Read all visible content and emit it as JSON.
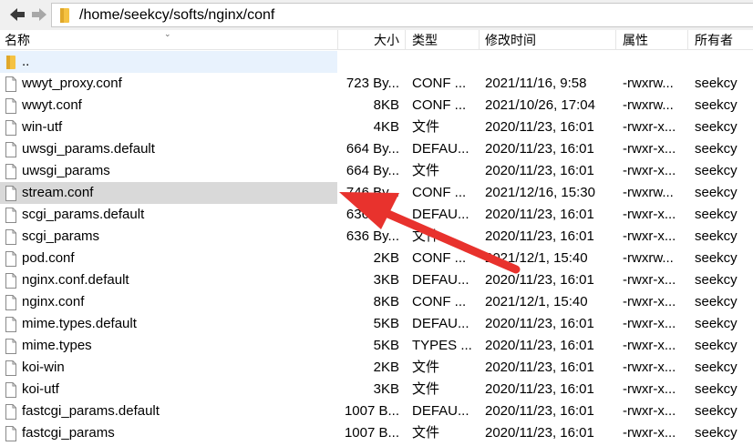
{
  "path": "/home/seekcy/softs/nginx/conf",
  "columns": {
    "name": "名称",
    "size": "大小",
    "type": "类型",
    "mtime": "修改时间",
    "perm": "属性",
    "owner": "所有者"
  },
  "parent_label": "..",
  "files": [
    {
      "name": "wwyt_proxy.conf",
      "size": "723 By...",
      "type": "CONF ...",
      "mtime": "2021/11/16, 9:58",
      "perm": "-rwxrw...",
      "owner": "seekcy"
    },
    {
      "name": "wwyt.conf",
      "size": "8KB",
      "type": "CONF ...",
      "mtime": "2021/10/26, 17:04",
      "perm": "-rwxrw...",
      "owner": "seekcy"
    },
    {
      "name": "win-utf",
      "size": "4KB",
      "type": "文件",
      "mtime": "2020/11/23, 16:01",
      "perm": "-rwxr-x...",
      "owner": "seekcy"
    },
    {
      "name": "uwsgi_params.default",
      "size": "664 By...",
      "type": "DEFAU...",
      "mtime": "2020/11/23, 16:01",
      "perm": "-rwxr-x...",
      "owner": "seekcy"
    },
    {
      "name": "uwsgi_params",
      "size": "664 By...",
      "type": "文件",
      "mtime": "2020/11/23, 16:01",
      "perm": "-rwxr-x...",
      "owner": "seekcy"
    },
    {
      "name": "stream.conf",
      "size": "746 By...",
      "type": "CONF ...",
      "mtime": "2021/12/16, 15:30",
      "perm": "-rwxrw...",
      "owner": "seekcy"
    },
    {
      "name": "scgi_params.default",
      "size": "636 By...",
      "type": "DEFAU...",
      "mtime": "2020/11/23, 16:01",
      "perm": "-rwxr-x...",
      "owner": "seekcy"
    },
    {
      "name": "scgi_params",
      "size": "636 By...",
      "type": "文件",
      "mtime": "2020/11/23, 16:01",
      "perm": "-rwxr-x...",
      "owner": "seekcy"
    },
    {
      "name": "pod.conf",
      "size": "2KB",
      "type": "CONF ...",
      "mtime": "2021/12/1, 15:40",
      "perm": "-rwxrw...",
      "owner": "seekcy"
    },
    {
      "name": "nginx.conf.default",
      "size": "3KB",
      "type": "DEFAU...",
      "mtime": "2020/11/23, 16:01",
      "perm": "-rwxr-x...",
      "owner": "seekcy"
    },
    {
      "name": "nginx.conf",
      "size": "8KB",
      "type": "CONF ...",
      "mtime": "2021/12/1, 15:40",
      "perm": "-rwxr-x...",
      "owner": "seekcy"
    },
    {
      "name": "mime.types.default",
      "size": "5KB",
      "type": "DEFAU...",
      "mtime": "2020/11/23, 16:01",
      "perm": "-rwxr-x...",
      "owner": "seekcy"
    },
    {
      "name": "mime.types",
      "size": "5KB",
      "type": "TYPES ...",
      "mtime": "2020/11/23, 16:01",
      "perm": "-rwxr-x...",
      "owner": "seekcy"
    },
    {
      "name": "koi-win",
      "size": "2KB",
      "type": "文件",
      "mtime": "2020/11/23, 16:01",
      "perm": "-rwxr-x...",
      "owner": "seekcy"
    },
    {
      "name": "koi-utf",
      "size": "3KB",
      "type": "文件",
      "mtime": "2020/11/23, 16:01",
      "perm": "-rwxr-x...",
      "owner": "seekcy"
    },
    {
      "name": "fastcgi_params.default",
      "size": "1007 B...",
      "type": "DEFAU...",
      "mtime": "2020/11/23, 16:01",
      "perm": "-rwxr-x...",
      "owner": "seekcy"
    },
    {
      "name": "fastcgi_params",
      "size": "1007 B...",
      "type": "文件",
      "mtime": "2020/11/23, 16:01",
      "perm": "-rwxr-x...",
      "owner": "seekcy"
    }
  ],
  "selected_index": 5,
  "icons": {
    "back": "arrow-left-icon",
    "forward": "arrow-right-icon",
    "folder": "folder-icon",
    "file": "file-icon"
  },
  "colors": {
    "annotation_arrow": "#e8322d",
    "selected_row": "#d9d9d9",
    "parent_row": "#e8f2fd",
    "folder": "#f5c242"
  }
}
